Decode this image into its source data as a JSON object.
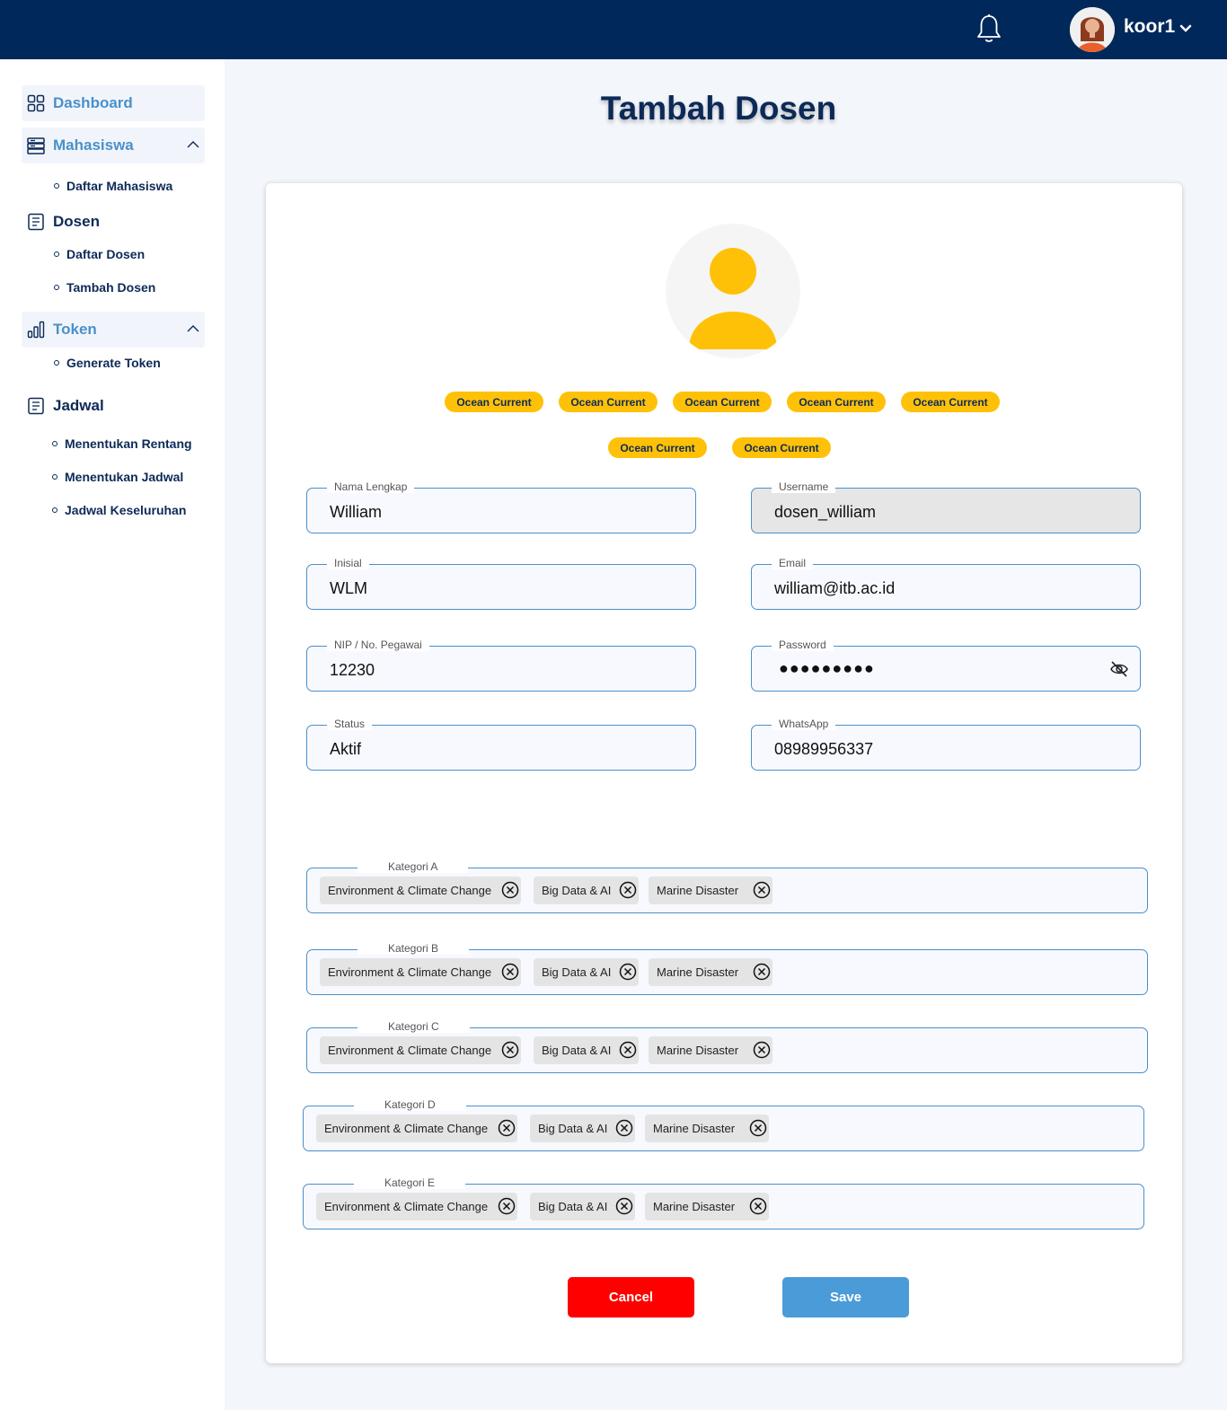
{
  "header": {
    "username": "koor1"
  },
  "sidebar": {
    "dashboard": "Dashboard",
    "mahasiswa": {
      "label": "Mahasiswa",
      "items": [
        "Daftar Mahasiswa"
      ]
    },
    "dosen": {
      "label": "Dosen",
      "items": [
        "Daftar Dosen",
        "Tambah Dosen"
      ]
    },
    "token": {
      "label": "Token",
      "items": [
        "Generate Token"
      ]
    },
    "jadwal": {
      "label": "Jadwal",
      "items": [
        "Menentukan Rentang",
        "Menentukan Jadwal",
        "Jadwal Keseluruhan"
      ]
    }
  },
  "page": {
    "title": "Tambah Dosen"
  },
  "badges": [
    "Ocean Current",
    "Ocean Current",
    "Ocean Current",
    "Ocean Current",
    "Ocean Current",
    "Ocean Current",
    "Ocean Current"
  ],
  "form": {
    "nama": {
      "label": "Nama Lengkap",
      "value": "William"
    },
    "username": {
      "label": "Username",
      "value": "dosen_william"
    },
    "inisial": {
      "label": "Inisial",
      "value": "WLM"
    },
    "email": {
      "label": "Email",
      "value": "william@itb.ac.id"
    },
    "nip": {
      "label": "NIP / No. Pegawai",
      "value": "12230"
    },
    "password": {
      "label": "Password",
      "value": "●●●●●●●●●"
    },
    "status": {
      "label": "Status",
      "value": "Aktif"
    },
    "whatsapp": {
      "label": "WhatsApp",
      "value": "08989956337"
    }
  },
  "kategori": [
    {
      "label": "Kategori A",
      "chips": [
        "Environment & Climate Change",
        "Big Data & AI",
        "Marine Disaster"
      ]
    },
    {
      "label": "Kategori B",
      "chips": [
        "Environment & Climate Change",
        "Big Data & AI",
        "Marine Disaster"
      ]
    },
    {
      "label": "Kategori C",
      "chips": [
        "Environment & Climate Change",
        "Big Data & AI",
        "Marine Disaster"
      ]
    },
    {
      "label": "Kategori D",
      "chips": [
        "Environment & Climate Change",
        "Big Data & AI",
        "Marine Disaster"
      ]
    },
    {
      "label": "Kategori E",
      "chips": [
        "Environment & Climate Change",
        "Big Data & AI",
        "Marine Disaster"
      ]
    }
  ],
  "buttons": {
    "cancel": "Cancel",
    "save": "Save"
  },
  "colors": {
    "navy": "#00285A",
    "accent_blue": "#4A90C9",
    "badge_yellow": "#FFC107",
    "cancel_red": "#FF0000",
    "save_blue": "#4A9BD8"
  }
}
